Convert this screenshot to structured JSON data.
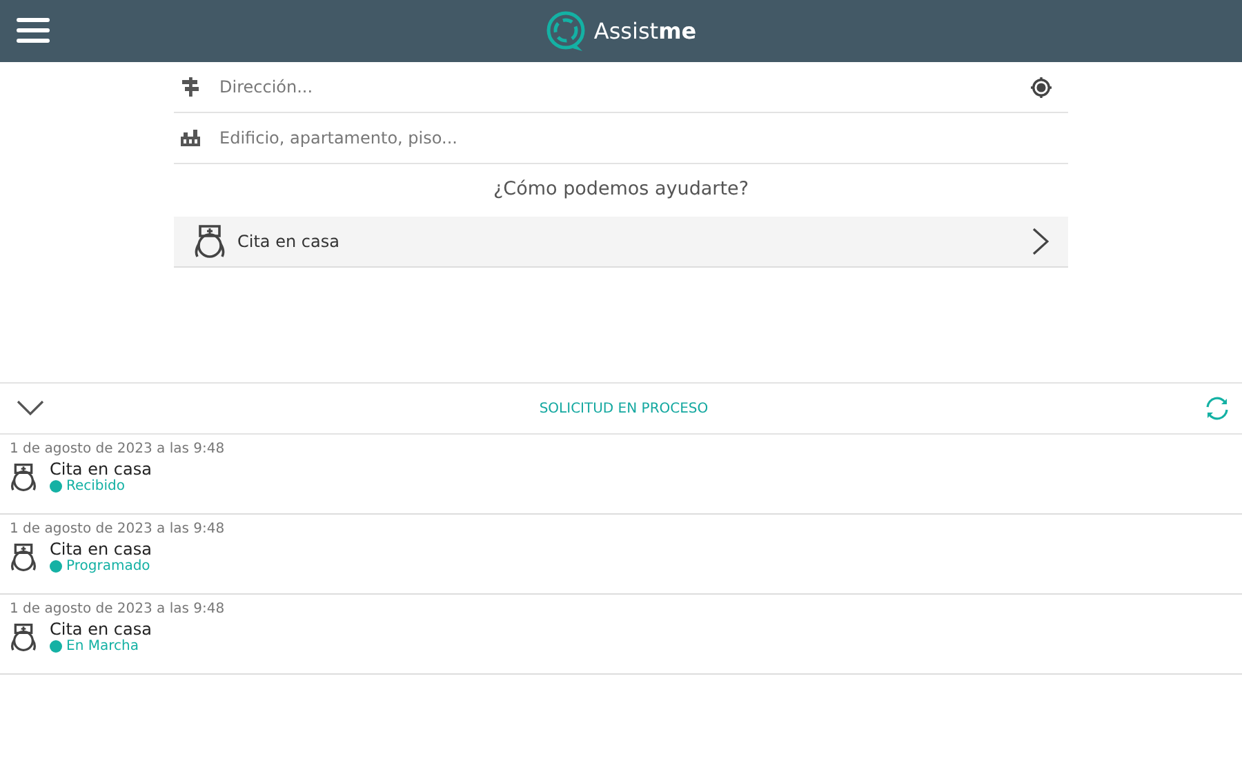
{
  "header": {
    "logo": "Assist**me**"
  },
  "form": {
    "fields": [
      {
        "kind": "address",
        "placeholder": "Dirección..."
      },
      {
        "kind": "building",
        "placeholder": "Edificio, apartamento, piso..."
      }
    ],
    "question": "¿Cómo podemos ayudarte?",
    "services": [
      {
        "label": "Cita en casa"
      }
    ]
  },
  "requests": {
    "title": "SOLICITUD EN PROCESO",
    "expanded": true,
    "items": [
      {
        "date": "1 de agosto de 2023 a las 9:48",
        "service": "Cita en casa",
        "status": "Recibido",
        "color": "#14b1a4"
      },
      {
        "date": "1 de agosto de 2023 a las 9:48",
        "service": "Cita en casa",
        "status": "Programado",
        "color": "#14b1a4"
      },
      {
        "date": "1 de agosto de 2023 a las 9:48",
        "service": "Cita en casa",
        "status": "En Marcha",
        "color": "#14b1a4"
      }
    ]
  }
}
